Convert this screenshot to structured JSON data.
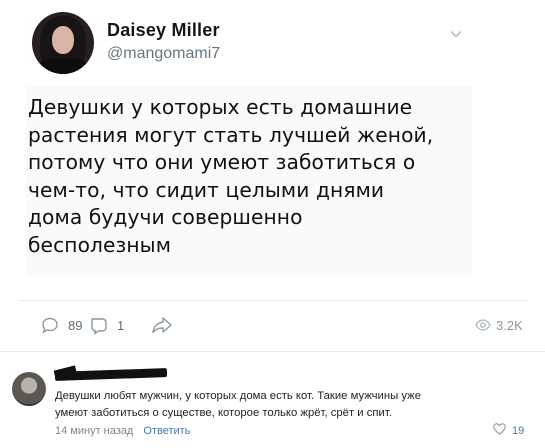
{
  "tweet": {
    "display_name": "Daisey Miller",
    "handle": "@mangomami7",
    "text_lines": [
      "Девушки у которых есть домашние",
      "растения могут стать лучшей женой,",
      "потому что они умеют заботиться о",
      "чем-то, что сидит целыми днями",
      "дома будучи совершенно",
      "бесполезным"
    ],
    "replies": "89",
    "retweets": "1",
    "views": "3.2K"
  },
  "comment": {
    "text_lines": [
      "Девушки любят мужчин, у которых дома есть кот. Такие мужчины уже",
      "умеют заботиться о существе, которое только жрёт, срёт и спит."
    ],
    "time": "14 минут назад",
    "reply_label": "Ответить",
    "likes": "19"
  },
  "icons": {
    "chevron": "chevron-down-icon",
    "reply": "reply-icon",
    "retweet": "retweet-icon",
    "share": "share-icon",
    "views": "eye-icon",
    "like": "heart-icon"
  },
  "colors": {
    "link": "#4a76a8",
    "muted": "#657786"
  }
}
